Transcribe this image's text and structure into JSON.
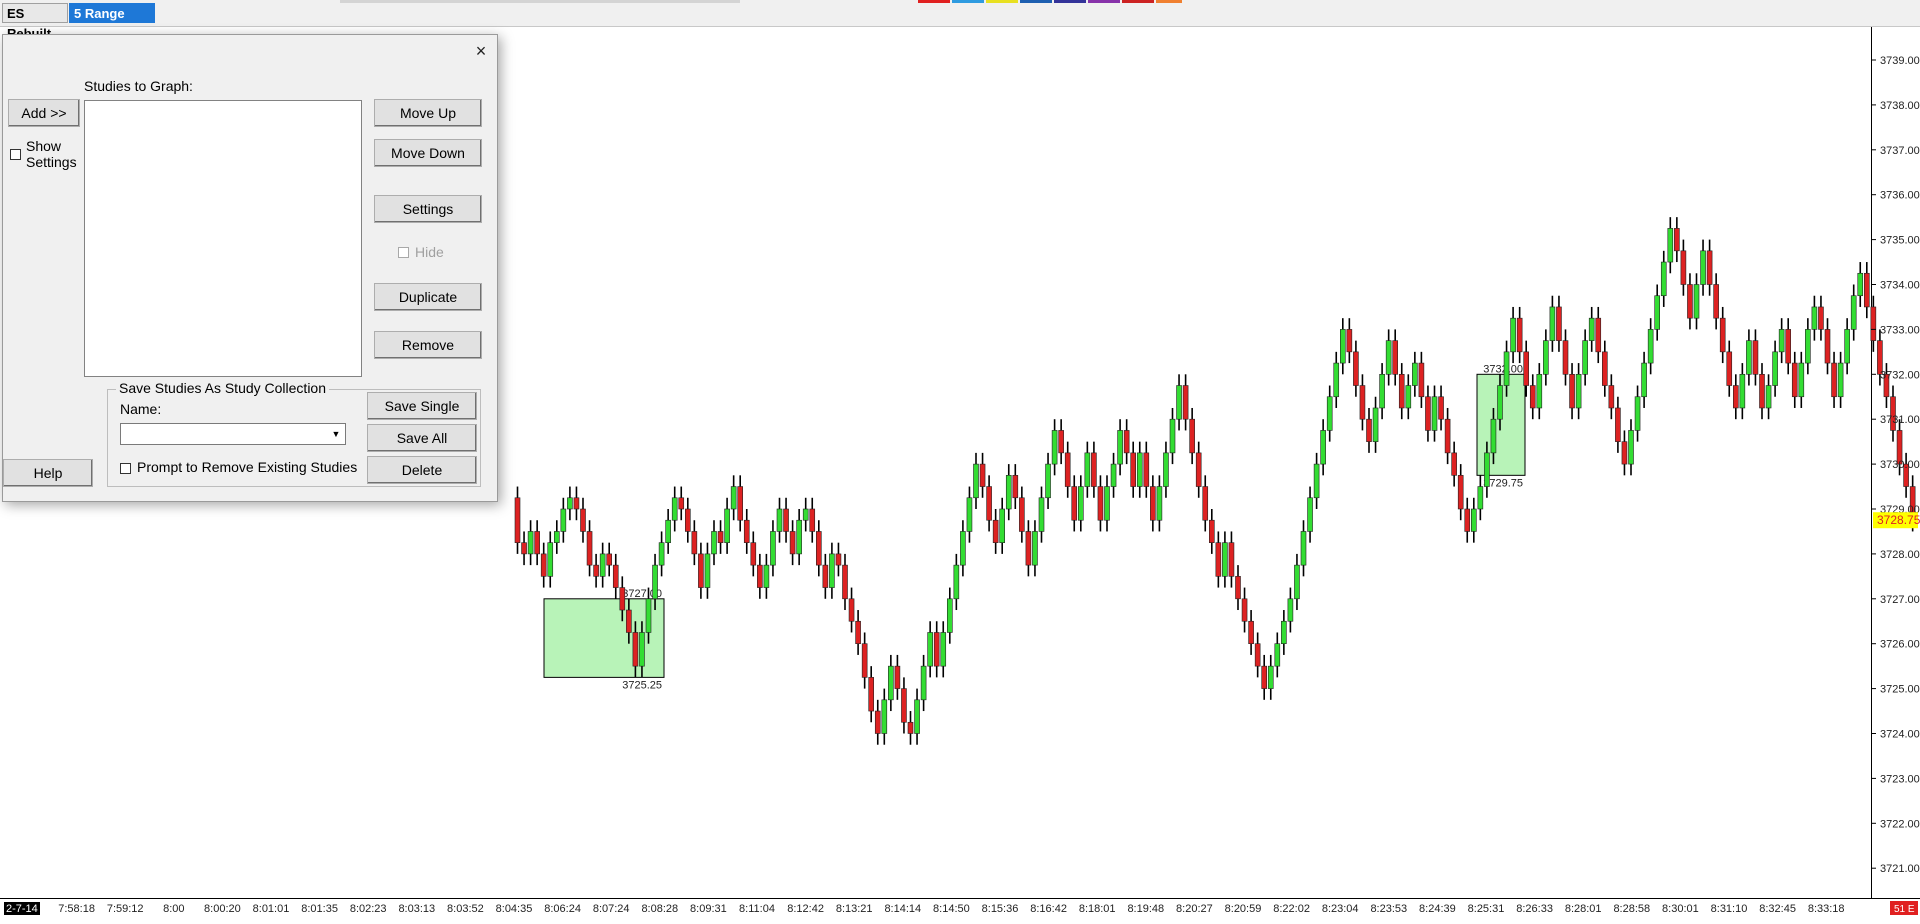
{
  "tabs": {
    "chart_name": "ES Rebuilt",
    "chart_type": "5 Range Chart"
  },
  "dialog": {
    "close_label": "×",
    "studies_label": "Studies to Graph:",
    "add_button": "Add >>",
    "show_settings_label": "Show\nSettings",
    "move_up_button": "Move Up",
    "move_down_button": "Move Down",
    "settings_button": "Settings",
    "hide_label": "Hide",
    "duplicate_button": "Duplicate",
    "remove_button": "Remove",
    "help_button": "Help",
    "collection_group_title": "Save Studies As Study Collection",
    "name_label": "Name:",
    "name_value": "",
    "prompt_remove_label": "Prompt to Remove Existing Studies",
    "save_single_button": "Save Single",
    "save_all_button": "Save All",
    "delete_button": "Delete"
  },
  "colors": {
    "bullish": "#33dd33",
    "bearish": "#dd2222",
    "zone_fill": "#b8f3b8",
    "last_price_bg": "#ffff00",
    "last_price_text": "#dd2222"
  },
  "chart_data": {
    "type": "candlestick",
    "y_ticks": [
      "3739.00",
      "3738.00",
      "3737.00",
      "3736.00",
      "3735.00",
      "3734.00",
      "3733.00",
      "3732.00",
      "3731.00",
      "3730.00",
      "3729.00",
      "3728.00",
      "3727.00",
      "3726.00",
      "3725.00",
      "3724.00",
      "3723.00",
      "3722.00",
      "3721.00"
    ],
    "ylim": [
      3720.5,
      3739.5
    ],
    "x_ticks": [
      "2-7-14",
      "7:58:18",
      "7:59:12",
      "8:00",
      "8:00:20",
      "8:01:01",
      "8:01:35",
      "8:02:23",
      "8:03:13",
      "8:03:52",
      "8:04:35",
      "8:06:24",
      "8:07:24",
      "8:08:28",
      "8:09:31",
      "8:11:04",
      "8:12:42",
      "8:13:21",
      "8:14:14",
      "8:14:50",
      "8:15:36",
      "8:16:42",
      "8:18:01",
      "8:19:48",
      "8:20:27",
      "8:20:59",
      "8:22:02",
      "8:23:04",
      "8:23:53",
      "8:24:39",
      "8:25:31",
      "8:26:33",
      "8:28:01",
      "8:28:58",
      "8:30:01",
      "8:31:10",
      "8:32:45",
      "8:33:18"
    ],
    "last_price": "3728.75",
    "corner_label": "51 E",
    "zones": [
      {
        "start_index": 0,
        "end_index": 14,
        "top": 3727.0,
        "bottom": 3725.25,
        "top_label": "3727.00",
        "bottom_label": "3725.25"
      },
      {
        "start_index": 126,
        "end_index": 131,
        "top": 3732.0,
        "bottom": 3729.75,
        "top_label": "3732.00",
        "bottom_label": "3729.75"
      }
    ],
    "candles_start": [
      3729.25,
      1
    ],
    "path": [
      [
        3728.25,
        -1
      ],
      [
        3728.0,
        -1
      ],
      [
        3728.5,
        1
      ],
      [
        3728.0,
        -1
      ],
      [
        3727.5,
        -1
      ],
      [
        3728.25,
        1
      ],
      [
        3728.5,
        1
      ],
      [
        3729.0,
        1
      ],
      [
        3729.25,
        1
      ],
      [
        3729.0,
        -1
      ],
      [
        3728.5,
        -1
      ],
      [
        3727.75,
        -1
      ],
      [
        3727.5,
        -1
      ],
      [
        3728.0,
        1
      ],
      [
        3727.75,
        -1
      ],
      [
        3727.25,
        -1
      ],
      [
        3726.75,
        -1
      ],
      [
        3726.25,
        -1
      ],
      [
        3725.5,
        -1
      ],
      [
        3726.25,
        1
      ],
      [
        3727.0,
        1
      ],
      [
        3727.75,
        1
      ],
      [
        3728.25,
        1
      ],
      [
        3728.75,
        1
      ],
      [
        3729.25,
        1
      ],
      [
        3729.0,
        -1
      ],
      [
        3728.5,
        -1
      ],
      [
        3728.0,
        -1
      ],
      [
        3727.25,
        -1
      ],
      [
        3728.0,
        1
      ],
      [
        3728.5,
        1
      ],
      [
        3728.25,
        -1
      ],
      [
        3729.0,
        1
      ],
      [
        3729.5,
        1
      ],
      [
        3728.75,
        -1
      ],
      [
        3728.25,
        -1
      ],
      [
        3727.75,
        -1
      ],
      [
        3727.25,
        -1
      ],
      [
        3727.75,
        1
      ],
      [
        3728.5,
        1
      ],
      [
        3729.0,
        1
      ],
      [
        3728.5,
        -1
      ],
      [
        3728.0,
        -1
      ],
      [
        3728.75,
        1
      ],
      [
        3729.0,
        1
      ],
      [
        3728.5,
        -1
      ],
      [
        3727.75,
        -1
      ],
      [
        3727.25,
        -1
      ],
      [
        3728.0,
        1
      ],
      [
        3727.75,
        -1
      ],
      [
        3727.0,
        -1
      ],
      [
        3726.5,
        -1
      ],
      [
        3726.0,
        -1
      ],
      [
        3725.25,
        -1
      ],
      [
        3724.5,
        -1
      ],
      [
        3724.0,
        -1
      ],
      [
        3724.75,
        1
      ],
      [
        3725.5,
        1
      ],
      [
        3725.0,
        -1
      ],
      [
        3724.25,
        -1
      ],
      [
        3724.0,
        -1
      ],
      [
        3724.75,
        1
      ],
      [
        3725.5,
        1
      ],
      [
        3726.25,
        1
      ],
      [
        3725.5,
        -1
      ],
      [
        3726.25,
        1
      ],
      [
        3727.0,
        1
      ],
      [
        3727.75,
        1
      ],
      [
        3728.5,
        1
      ],
      [
        3729.25,
        1
      ],
      [
        3730.0,
        1
      ],
      [
        3729.5,
        -1
      ],
      [
        3728.75,
        -1
      ],
      [
        3728.25,
        -1
      ],
      [
        3729.0,
        1
      ],
      [
        3729.75,
        1
      ],
      [
        3729.25,
        -1
      ],
      [
        3728.5,
        -1
      ],
      [
        3727.75,
        -1
      ],
      [
        3728.5,
        1
      ],
      [
        3729.25,
        1
      ],
      [
        3730.0,
        1
      ],
      [
        3730.75,
        1
      ],
      [
        3730.25,
        -1
      ],
      [
        3729.5,
        -1
      ],
      [
        3728.75,
        -1
      ],
      [
        3729.5,
        1
      ],
      [
        3730.25,
        1
      ],
      [
        3729.5,
        -1
      ],
      [
        3728.75,
        -1
      ],
      [
        3729.5,
        1
      ],
      [
        3730.0,
        1
      ],
      [
        3730.75,
        1
      ],
      [
        3730.25,
        -1
      ],
      [
        3729.5,
        -1
      ],
      [
        3730.25,
        1
      ],
      [
        3729.5,
        -1
      ],
      [
        3728.75,
        -1
      ],
      [
        3729.5,
        1
      ],
      [
        3730.25,
        1
      ],
      [
        3731.0,
        1
      ],
      [
        3731.75,
        1
      ],
      [
        3731.0,
        -1
      ],
      [
        3730.25,
        -1
      ],
      [
        3729.5,
        -1
      ],
      [
        3728.75,
        -1
      ],
      [
        3728.25,
        -1
      ],
      [
        3727.5,
        -1
      ],
      [
        3728.25,
        1
      ],
      [
        3727.5,
        -1
      ],
      [
        3727.0,
        -1
      ],
      [
        3726.5,
        -1
      ],
      [
        3726.0,
        -1
      ],
      [
        3725.5,
        -1
      ],
      [
        3725.0,
        -1
      ],
      [
        3725.5,
        1
      ],
      [
        3726.0,
        1
      ],
      [
        3726.5,
        1
      ],
      [
        3727.0,
        1
      ],
      [
        3727.75,
        1
      ],
      [
        3728.5,
        1
      ],
      [
        3729.25,
        1
      ],
      [
        3730.0,
        1
      ],
      [
        3730.75,
        1
      ],
      [
        3731.5,
        1
      ],
      [
        3732.25,
        1
      ],
      [
        3733.0,
        1
      ],
      [
        3732.5,
        -1
      ],
      [
        3731.75,
        -1
      ],
      [
        3731.0,
        -1
      ],
      [
        3730.5,
        -1
      ],
      [
        3731.25,
        1
      ],
      [
        3732.0,
        1
      ],
      [
        3732.75,
        1
      ],
      [
        3732.0,
        -1
      ],
      [
        3731.25,
        -1
      ],
      [
        3731.75,
        1
      ],
      [
        3732.25,
        1
      ],
      [
        3731.5,
        -1
      ],
      [
        3730.75,
        -1
      ],
      [
        3731.5,
        1
      ],
      [
        3731.0,
        -1
      ],
      [
        3730.25,
        -1
      ],
      [
        3729.75,
        -1
      ],
      [
        3729.0,
        -1
      ],
      [
        3728.5,
        -1
      ],
      [
        3729.0,
        1
      ],
      [
        3729.5,
        1
      ],
      [
        3730.25,
        1
      ],
      [
        3731.0,
        1
      ],
      [
        3731.75,
        1
      ],
      [
        3732.5,
        1
      ],
      [
        3733.25,
        1
      ],
      [
        3732.5,
        -1
      ],
      [
        3731.75,
        -1
      ],
      [
        3731.25,
        -1
      ],
      [
        3732.0,
        1
      ],
      [
        3732.75,
        1
      ],
      [
        3733.5,
        1
      ],
      [
        3732.75,
        -1
      ],
      [
        3732.0,
        -1
      ],
      [
        3731.25,
        -1
      ],
      [
        3732.0,
        1
      ],
      [
        3732.75,
        1
      ],
      [
        3733.25,
        1
      ],
      [
        3732.5,
        -1
      ],
      [
        3731.75,
        -1
      ],
      [
        3731.25,
        -1
      ],
      [
        3730.5,
        -1
      ],
      [
        3730.0,
        -1
      ],
      [
        3730.75,
        1
      ],
      [
        3731.5,
        1
      ],
      [
        3732.25,
        1
      ],
      [
        3733.0,
        1
      ],
      [
        3733.75,
        1
      ],
      [
        3734.5,
        1
      ],
      [
        3735.25,
        1
      ],
      [
        3734.75,
        -1
      ],
      [
        3734.0,
        -1
      ],
      [
        3733.25,
        -1
      ],
      [
        3734.0,
        1
      ],
      [
        3734.75,
        1
      ],
      [
        3734.0,
        -1
      ],
      [
        3733.25,
        -1
      ],
      [
        3732.5,
        -1
      ],
      [
        3731.75,
        -1
      ],
      [
        3731.25,
        -1
      ],
      [
        3732.0,
        1
      ],
      [
        3732.75,
        1
      ],
      [
        3732.0,
        -1
      ],
      [
        3731.25,
        -1
      ],
      [
        3731.75,
        1
      ],
      [
        3732.5,
        1
      ],
      [
        3733.0,
        1
      ],
      [
        3732.25,
        -1
      ],
      [
        3731.5,
        -1
      ],
      [
        3732.25,
        1
      ],
      [
        3733.0,
        1
      ],
      [
        3733.5,
        1
      ],
      [
        3733.0,
        -1
      ],
      [
        3732.25,
        -1
      ],
      [
        3731.5,
        -1
      ],
      [
        3732.25,
        1
      ],
      [
        3733.0,
        1
      ],
      [
        3733.75,
        1
      ],
      [
        3734.25,
        1
      ],
      [
        3733.5,
        -1
      ],
      [
        3732.75,
        -1
      ],
      [
        3732.0,
        -1
      ],
      [
        3731.5,
        -1
      ],
      [
        3730.75,
        -1
      ],
      [
        3730.0,
        -1
      ],
      [
        3729.5,
        -1
      ],
      [
        3728.75,
        -1
      ]
    ]
  }
}
